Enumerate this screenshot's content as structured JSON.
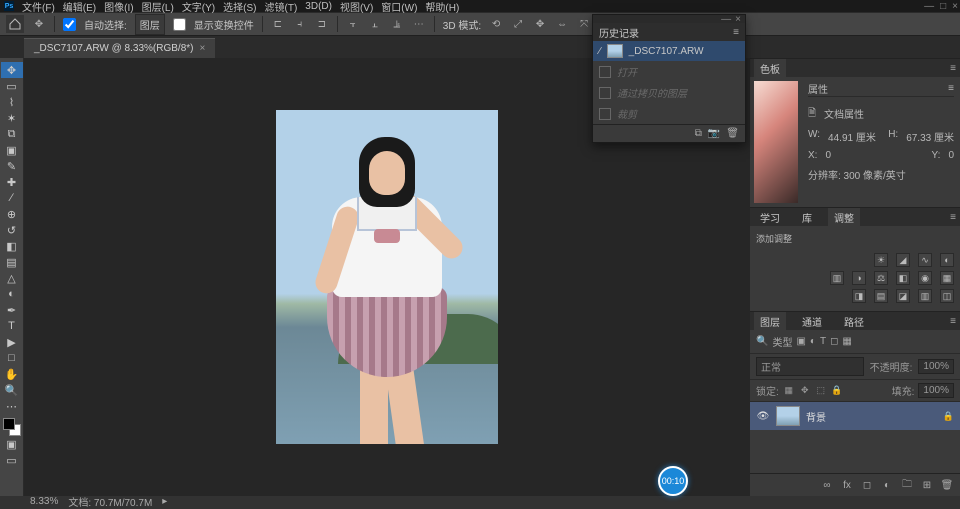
{
  "app": {
    "ps_badge": "Ps"
  },
  "menu": [
    "文件(F)",
    "编辑(E)",
    "图像(I)",
    "图层(L)",
    "文字(Y)",
    "选择(S)",
    "滤镜(T)",
    "3D(D)",
    "视图(V)",
    "窗口(W)",
    "帮助(H)"
  ],
  "window_controls": {
    "min": "—",
    "max": "□",
    "close": "×"
  },
  "options": {
    "auto_select": "自动选择:",
    "scope": "图层",
    "show_transform": "显示变换控件",
    "mode_label": "3D 模式:"
  },
  "doc_tab": {
    "title": "_DSC7107.ARW @ 8.33%(RGB/8*)",
    "close": "×"
  },
  "history": {
    "title": "历史记录",
    "current": "_DSC7107.ARW",
    "items": [
      "打开",
      "通过拷贝的图层",
      "裁剪"
    ]
  },
  "panels": {
    "color_tab": "色板",
    "properties_tab": "属性",
    "properties_doc": "文档属性",
    "w_label": "W:",
    "w_val": "44.91 厘米",
    "h_label": "H:",
    "h_val": "67.33 厘米",
    "x_label": "X:",
    "x_val": "0",
    "y_label": "Y:",
    "y_val": "0",
    "res": "分辨率: 300 像素/英寸",
    "learn_tab": "学习",
    "lib_tab": "库",
    "adjust_tab": "调整",
    "adjust_title": "添加调整",
    "layers_tab": "图层",
    "channels_tab": "通道",
    "paths_tab": "路径",
    "layer_type": "类型",
    "opacity_label": "不透明度:",
    "opacity_val": "100%",
    "blend_label": "正常",
    "fill_label": "填充:",
    "fill_val": "100%",
    "lock_label": "锁定:",
    "bg_layer": "背景"
  },
  "status": {
    "zoom": "8.33%",
    "info": "文档: 70.7M/70.7M"
  },
  "timer": "00:10"
}
